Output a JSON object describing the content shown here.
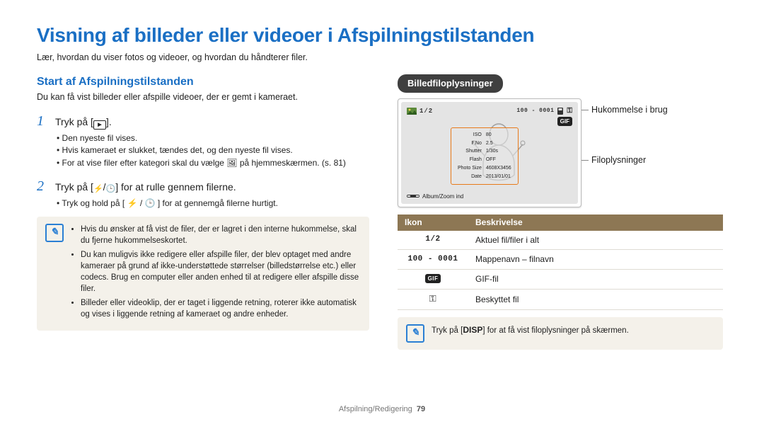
{
  "title": "Visning af billeder eller videoer i Afspilningstilstanden",
  "subtitle": "Lær, hvordan du viser fotos og videoer, og hvordan du håndterer filer.",
  "left": {
    "section_title": "Start af Afspilningstilstanden",
    "section_intro": "Du kan få vist billeder eller afspille videoer, der er gemt i kameraet.",
    "step1": {
      "num": "1",
      "text_before": "Tryk på [",
      "text_after": "].",
      "bullets": [
        "Den nyeste fil vises.",
        "Hvis kameraet er slukket, tændes det, og den nyeste fil vises.",
        "For at vise filer efter kategori skal du vælge 🖼 på hjemmeskærmen. (s. 81)"
      ]
    },
    "step2": {
      "num": "2",
      "text_before": "Tryk på [",
      "sep": "/",
      "text_after": "] for at rulle gennem filerne.",
      "bullets": [
        "Tryk og hold på [ ⚡ / 🕒 ] for at gennemgå filerne hurtigt."
      ]
    },
    "note_items": [
      "Hvis du ønsker at få vist de filer, der er lagret i den interne hukommelse, skal du fjerne hukommelseskortet.",
      "Du kan muligvis ikke redigere eller afspille filer, der blev optaget med andre kameraer på grund af ikke-understøttede størrelser (billedstørrelse etc.) eller codecs. Brug en computer eller anden enhed til at redigere eller afspille disse filer.",
      "Billeder eller videoklip, der er taget i liggende retning, roterer ikke automatisk og vises i liggende retning af kameraet og andre enheder."
    ]
  },
  "right": {
    "pill": "Billedfiloplysninger",
    "lcd": {
      "top_left_count": "1/2",
      "top_right_filename": "100 - 0001",
      "info_rows": [
        {
          "l": "ISO",
          "v": "80"
        },
        {
          "l": "F.No",
          "v": "2.5"
        },
        {
          "l": "Shutter",
          "v": "1/30s"
        },
        {
          "l": "Flash",
          "v": "OFF"
        },
        {
          "l": "Photo Size",
          "v": "4608X3456"
        },
        {
          "l": "Date",
          "v": "2013/01/01"
        }
      ],
      "bottom": "Album/Zoom ind"
    },
    "labels": {
      "memory": "Hukommelse i brug",
      "fileinfo": "Filoplysninger"
    },
    "table": {
      "headers": {
        "icon": "Ikon",
        "desc": "Beskrivelse"
      },
      "rows": [
        {
          "icon_text": "1/2",
          "icon_kind": "mono",
          "desc": "Aktuel fil/filer i alt"
        },
        {
          "icon_text": "100 - 0001",
          "icon_kind": "mono",
          "desc": "Mappenavn – filnavn"
        },
        {
          "icon_text": "GIF",
          "icon_kind": "gif",
          "desc": "GIF-fil"
        },
        {
          "icon_text": "⚿",
          "icon_kind": "key",
          "desc": "Beskyttet fil"
        }
      ]
    },
    "tip_prefix": "Tryk på [",
    "tip_disp": "DISP",
    "tip_suffix": "] for at få vist filoplysninger på skærmen."
  },
  "footer": {
    "section": "Afspilning/Redigering",
    "page": "79"
  }
}
